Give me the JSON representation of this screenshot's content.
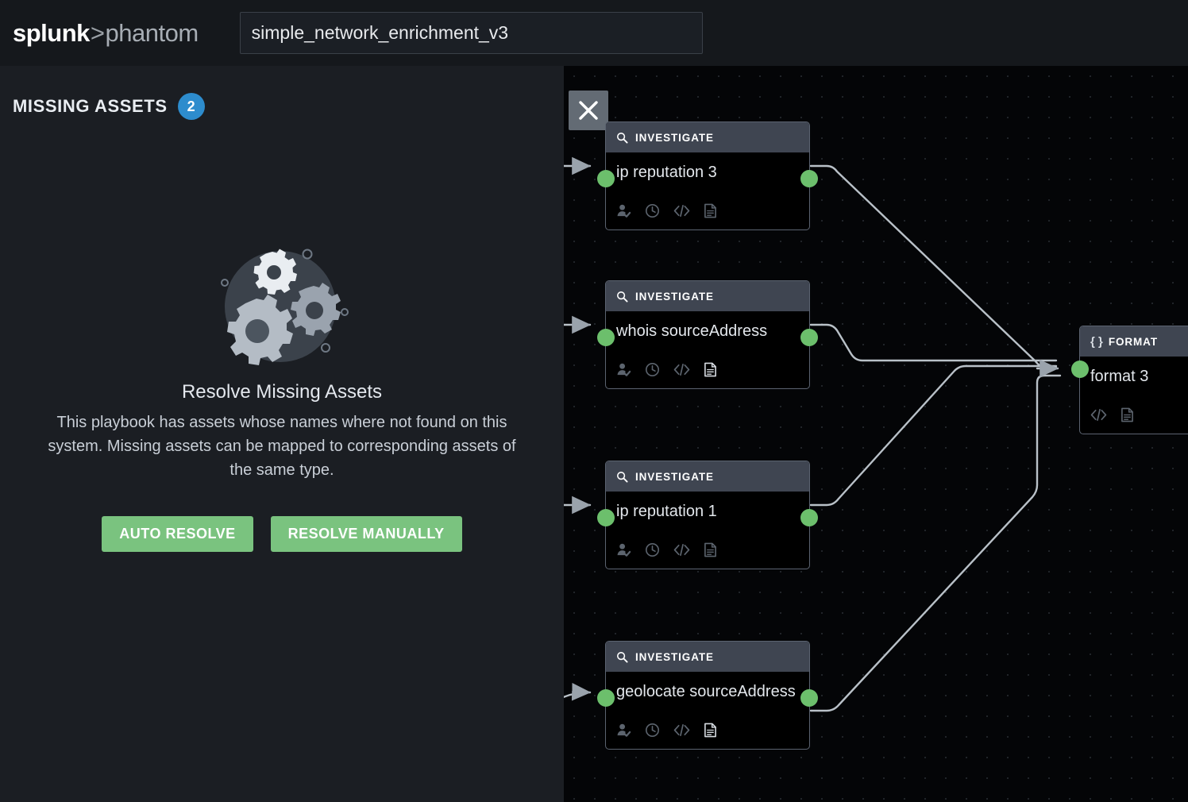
{
  "header": {
    "logo": {
      "splunk": "splunk",
      "caret": ">",
      "phantom": "phantom"
    },
    "playbook_name": "simple_network_enrichment_v3"
  },
  "panel": {
    "title": "MISSING ASSETS",
    "count": "2",
    "empty_state": {
      "title": "Resolve Missing Assets",
      "description": "This playbook has assets whose names where not found on this system. Missing assets can be mapped to corresponding assets of the same type.",
      "auto_resolve_label": "AUTO RESOLVE",
      "resolve_manually_label": "RESOLVE MANUALLY"
    }
  },
  "canvas": {
    "close_label": "close",
    "nodes": [
      {
        "kind": "INVESTIGATE",
        "label": "ip reputation 3",
        "icons": [
          "approver-icon",
          "clock-icon",
          "code-icon",
          "note-icon"
        ]
      },
      {
        "kind": "INVESTIGATE",
        "label": "whois sourceAddress",
        "icons": [
          "approver-icon",
          "clock-icon",
          "code-icon",
          "note-icon"
        ]
      },
      {
        "kind": "INVESTIGATE",
        "label": "ip reputation 1",
        "icons": [
          "approver-icon",
          "clock-icon",
          "code-icon",
          "note-icon"
        ]
      },
      {
        "kind": "INVESTIGATE",
        "label": "geolocate sourceAddress",
        "icons": [
          "approver-icon",
          "clock-icon",
          "code-icon",
          "note-icon"
        ]
      }
    ],
    "format_node": {
      "kind": "FORMAT",
      "icon_glyph": "{ }",
      "label": "format 3",
      "icons": [
        "code-icon",
        "note-icon"
      ]
    }
  },
  "colors": {
    "accent_green": "#7ac37f",
    "badge_blue": "#2d8ccd",
    "port_green": "#6cbf6c",
    "node_header": "#3f4551",
    "panel_bg": "#1b1e23",
    "canvas_bg": "#040507"
  }
}
